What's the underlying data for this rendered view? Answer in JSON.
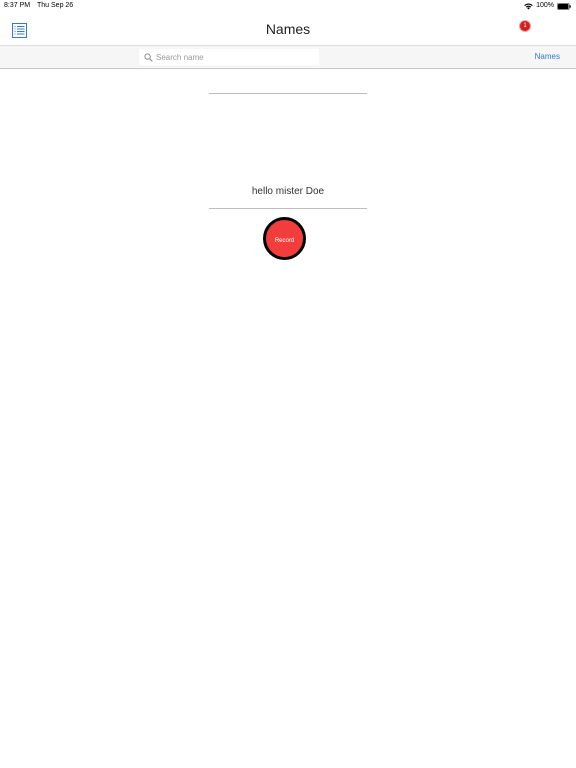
{
  "status_bar": {
    "time": "8:37 PM",
    "date": "Thu Sep 26",
    "battery_percent": "100%",
    "wifi_icon": "wifi-icon",
    "battery_icon": "battery-icon"
  },
  "nav": {
    "title": "Names",
    "list_icon": "list-icon",
    "badge_count": "1"
  },
  "search": {
    "placeholder": "Search name",
    "value": "",
    "names_link": "Names"
  },
  "content": {
    "greeting": "hello mister  Doe",
    "record_label": "Record"
  },
  "colors": {
    "accent": "#3478d4",
    "record": "#f23d3d",
    "badge": "#d21f1f"
  }
}
